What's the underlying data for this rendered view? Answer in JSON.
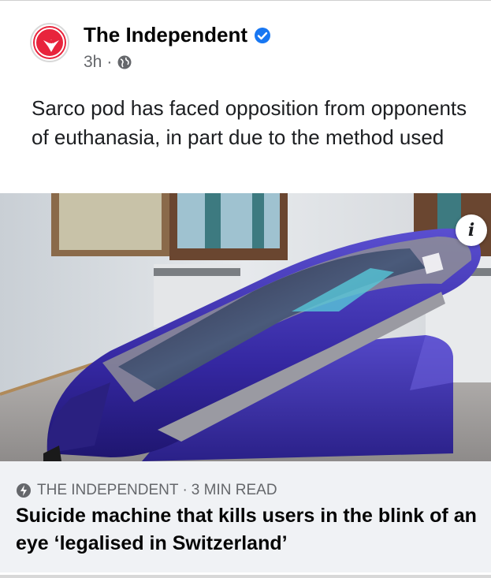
{
  "post": {
    "page_name": "The Independent",
    "timestamp": "3h",
    "separator": "·",
    "caption": "Sarco pod has faced opposition from opponents of euthanasia, in part due to the method used",
    "icons": {
      "avatar": "independent-eagle-logo",
      "verified": "verified-badge-icon",
      "privacy": "globe-icon",
      "info": "info-icon"
    },
    "image_info_glyph": "i"
  },
  "link_preview": {
    "source": "THE INDEPENDENT",
    "separator": "·",
    "read_time": "3 MIN READ",
    "headline": "Suicide machine that kills users in the blink of an eye ‘legalised in Switzerland’",
    "icon": "lightning-bolt-icon"
  },
  "colors": {
    "brand_red": "#e8243c",
    "verified_blue": "#1877f2",
    "pod_purple": "#3b2fa0",
    "preview_bg": "#f0f2f5"
  }
}
